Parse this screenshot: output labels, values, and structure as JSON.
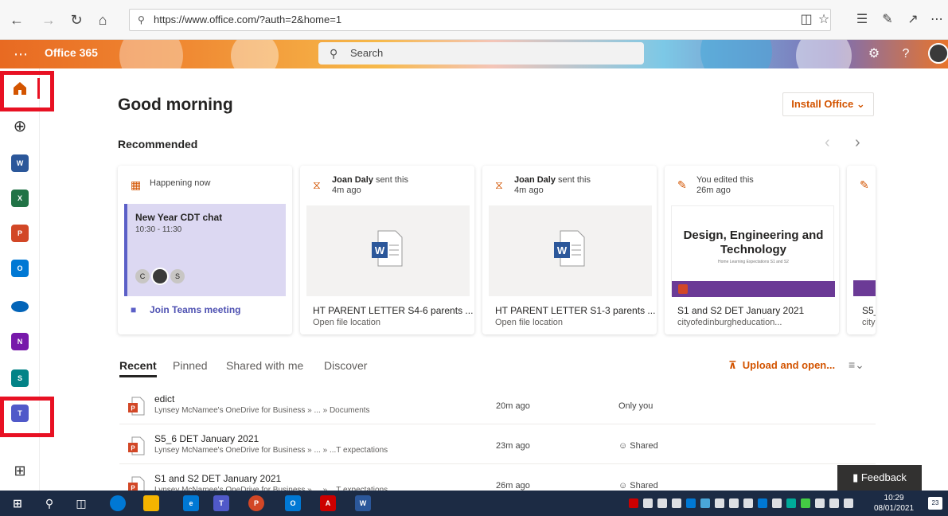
{
  "browser": {
    "url": "https://www.office.com/?auth=2&home=1",
    "back_icon": "arrow-left-icon",
    "forward_icon": "arrow-right-icon",
    "refresh_icon": "refresh-icon",
    "home_icon": "home-icon"
  },
  "header": {
    "brand": "Office 365",
    "search_placeholder": "Search"
  },
  "main": {
    "greeting": "Good morning",
    "install_label": "Install Office",
    "recommended_label": "Recommended",
    "cards": [
      {
        "kind": "meeting",
        "status": "Happening now",
        "event_title": "New Year CDT chat",
        "event_time": "10:30 - 11:30",
        "attendees": [
          "C",
          "S"
        ],
        "join_label": "Join Teams meeting"
      },
      {
        "kind": "file",
        "sender": "Joan Daly",
        "action": "sent this",
        "when": "4m ago",
        "title": "HT PARENT LETTER S4-6 parents ...",
        "sub": "Open file location"
      },
      {
        "kind": "file",
        "sender": "Joan Daly",
        "action": "sent this",
        "when": "4m ago",
        "title": "HT PARENT LETTER S1-3 parents ...",
        "sub": "Open file location"
      },
      {
        "kind": "slide",
        "action": "You edited this",
        "when": "26m ago",
        "slide_title": "Design, Engineering and Technology",
        "slide_sub": "Home Learning Expectations S1 and S2",
        "title": "S1 and S2 DET January 2021",
        "sub": "cityofedinburgheducation..."
      },
      {
        "kind": "partial",
        "title": "S5_",
        "sub": "city"
      }
    ],
    "tabs": [
      "Recent",
      "Pinned",
      "Shared with me",
      "Discover"
    ],
    "upload_label": "Upload and open...",
    "files": [
      {
        "name": "edict",
        "path": "Lynsey McNamee's OneDrive for Business » ... » Documents",
        "time": "20m ago",
        "sharing": "Only you"
      },
      {
        "name": "S5_6 DET January 2021",
        "path": "Lynsey McNamee's OneDrive for Business » ... » ...T expectations",
        "time": "23m ago",
        "sharing": "Shared"
      },
      {
        "name": "S1 and S2 DET January 2021",
        "path": "Lynsey McNamee's OneDrive for Business » ... » ...T expectations",
        "time": "26m ago",
        "sharing": "Shared"
      }
    ],
    "feedback_label": "Feedback"
  },
  "rail": {
    "apps": [
      {
        "name": "Word",
        "letter": "W",
        "color": "#2b579a"
      },
      {
        "name": "Excel",
        "letter": "X",
        "color": "#217346"
      },
      {
        "name": "PowerPoint",
        "letter": "P",
        "color": "#d24726"
      },
      {
        "name": "Outlook",
        "letter": "O",
        "color": "#0078d4"
      },
      {
        "name": "OneDrive",
        "letter": "",
        "color": "#0364b8"
      },
      {
        "name": "OneNote",
        "letter": "N",
        "color": "#7719aa"
      },
      {
        "name": "SharePoint",
        "letter": "S",
        "color": "#038387"
      },
      {
        "name": "Teams",
        "letter": "T",
        "color": "#5059c9"
      }
    ]
  },
  "taskbar": {
    "time": "10:29",
    "date": "08/01/2021",
    "notification_count": "23"
  },
  "colors": {
    "accent": "#d35400",
    "highlight": "#e81123",
    "taskbar": "#1c2b44"
  }
}
